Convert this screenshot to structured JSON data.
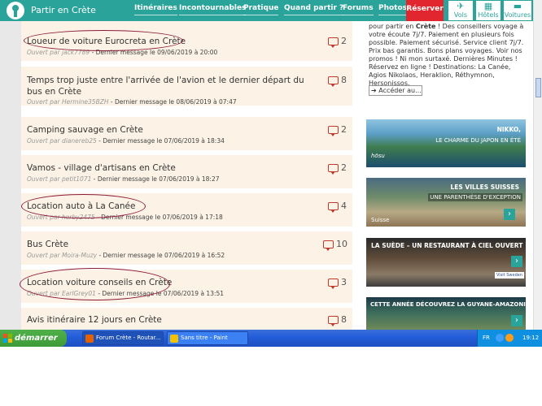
{
  "site": {
    "title": "Partir en Crète"
  },
  "nav": {
    "items": [
      "Itinéraires",
      "Incontournables",
      "Pratique",
      "Quand partir ?",
      "Forums",
      "Photos"
    ],
    "reserve": "Réserver",
    "flights": "Vols",
    "hotels": "Hôtels",
    "cars": "Voitures"
  },
  "topics": [
    {
      "title": "Loueur de voiture Eurocreta en Crète",
      "by": "Ouvert par jack7789",
      "last": " - Dernier message le 09/06/2019 à 20:00",
      "replies": "2",
      "circled": true
    },
    {
      "title": "Temps trop juste entre l'arrivée de l'avion et le dernier départ du bus en Crète",
      "by": "Ouvert par Hermine35BZH",
      "last": " - Dernier message le 08/06/2019 à 07:47",
      "replies": "8",
      "circled": false
    },
    {
      "title": "Camping sauvage en Crète",
      "by": "Ouvert par dianereb25",
      "last": " - Dernier message le 07/06/2019 à 18:34",
      "replies": "2",
      "circled": false
    },
    {
      "title": "Vamos - village d'artisans en Crète",
      "by": "Ouvert par petit1071",
      "last": " - Dernier message le 07/06/2019 à 18:27",
      "replies": "2",
      "circled": false
    },
    {
      "title": "Location auto à La Canée",
      "by": "Ouvert par herby2475",
      "last": " - Dernier message le 07/06/2019 à 17:18",
      "replies": "4",
      "circled": true
    },
    {
      "title": "Bus Crète",
      "by": "Ouvert par Moira-Muzy",
      "last": " - Dernier message le 07/06/2019 à 16:52",
      "replies": "10",
      "circled": false
    },
    {
      "title": "Location voiture conseils en Crète",
      "by": "Ouvert par EarlGrey01",
      "last": " - Dernier message le 07/06/2019 à 13:51",
      "replies": "3",
      "circled": true
    },
    {
      "title": "Avis itinéraire 12 jours en Crète",
      "by": "",
      "last": "",
      "replies": "8",
      "circled": false
    }
  ],
  "sidebar": {
    "promo_pre": "pour partir en ",
    "promo_bold": "Crète",
    "promo_post": " ! Des conseillers voyage à votre écoute 7j/7. Paiement en plusieurs fois possible. Paiement sécurisé. Service client 7j/7. Prix bas garantis. Bons plans voyages. Voir nos promos ! Ni mon surtaxé. Dernières Minutes ! Réservez en ligne ! Destinations: La Canée, Agios Nikolaos, Heraklion, Réthymnon, Hersonissos.",
    "promo_link": "Accéder au...",
    "ads": [
      {
        "top_label": "NIKKO,",
        "sub_label": "LE CHARME DU JAPON EN ÉTÉ",
        "brand": "hōsu"
      },
      {
        "top_label": "LES VILLES SUISSES",
        "sub_label": "UNE PARENTHÈSE D'EXCEPTION",
        "brand": "Suisse"
      },
      {
        "top_label": "LA SUÈDE – UN RESTAURANT À CIEL OUVERT",
        "sub_label": "",
        "brand": "Visit Sweden"
      },
      {
        "top_label": "CETTE ANNÉE DÉCOUVREZ LA GUYANE-AMAZONIE",
        "sub_label": "",
        "brand": ""
      }
    ]
  },
  "taskbar": {
    "start": "démarrer",
    "tasks": [
      "Forum Crète - Routar...",
      "Sans titre - Paint"
    ],
    "lang": "FR",
    "time": "19:12"
  }
}
